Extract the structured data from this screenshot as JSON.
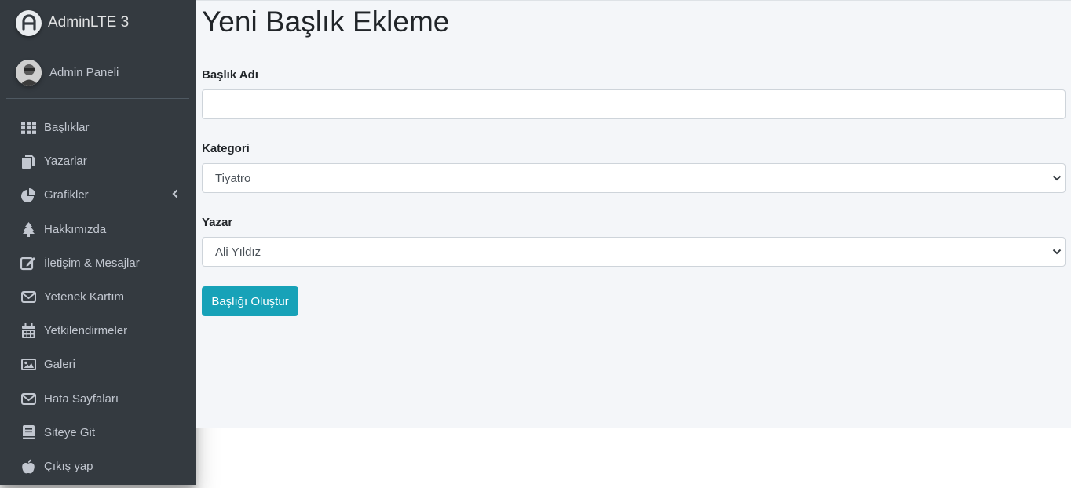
{
  "brand": {
    "title": "AdminLTE 3",
    "logo_icon": "adminlte-logo-icon"
  },
  "user": {
    "name": "Admin Paneli",
    "avatar_icon": "user-avatar"
  },
  "sidebar": {
    "items": [
      {
        "label": "Başlıklar",
        "icon": "grid-icon"
      },
      {
        "label": "Yazarlar",
        "icon": "copy-icon"
      },
      {
        "label": "Grafikler",
        "icon": "pie-chart-icon",
        "has_chevron": true
      },
      {
        "label": "Hakkımızda",
        "icon": "tree-icon"
      },
      {
        "label": "İletişim & Mesajlar",
        "icon": "edit-icon"
      },
      {
        "label": "Yetenek Kartım",
        "icon": "envelope-icon"
      },
      {
        "label": "Yetkilendirmeler",
        "icon": "calendar-icon"
      },
      {
        "label": "Galeri",
        "icon": "image-icon"
      },
      {
        "label": "Hata Sayfaları",
        "icon": "envelope-icon"
      },
      {
        "label": "Siteye Git",
        "icon": "book-icon"
      },
      {
        "label": "Çıkış yap",
        "icon": "apple-icon"
      }
    ]
  },
  "main": {
    "title": "Yeni Başlık Ekleme",
    "fields": {
      "title_label": "Başlık Adı",
      "title_value": "",
      "category_label": "Kategori",
      "category_value": "Tiyatro",
      "author_label": "Yazar",
      "author_value": "Ali Yıldız"
    },
    "submit_label": "Başlığı Oluştur"
  },
  "colors": {
    "sidebar_bg": "#343a40",
    "content_bg": "#f4f6f9",
    "button_bg": "#17a2b8",
    "sidebar_text": "#c2c7d0"
  }
}
